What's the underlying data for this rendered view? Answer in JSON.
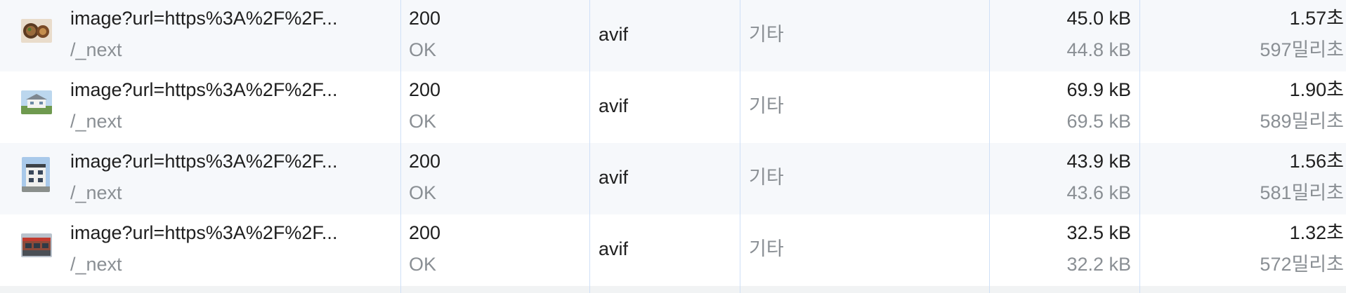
{
  "rows": [
    {
      "thumb_icon": "food-thumbnail-icon",
      "name": "image?url=https%3A%2F%2F...",
      "path": "/_next",
      "status_code": "200",
      "status_text": "OK",
      "type": "avif",
      "initiator": "기타",
      "transferred": "45.0 kB",
      "size": "44.8 kB",
      "time": "1.57초",
      "latency": "597밀리초"
    },
    {
      "thumb_icon": "house-thumbnail-icon",
      "name": "image?url=https%3A%2F%2F...",
      "path": "/_next",
      "status_code": "200",
      "status_text": "OK",
      "type": "avif",
      "initiator": "기타",
      "transferred": "69.9 kB",
      "size": "69.5 kB",
      "time": "1.90초",
      "latency": "589밀리초"
    },
    {
      "thumb_icon": "building-thumbnail-icon",
      "name": "image?url=https%3A%2F%2F...",
      "path": "/_next",
      "status_code": "200",
      "status_text": "OK",
      "type": "avif",
      "initiator": "기타",
      "transferred": "43.9 kB",
      "size": "43.6 kB",
      "time": "1.56초",
      "latency": "581밀리초"
    },
    {
      "thumb_icon": "storefront-thumbnail-icon",
      "name": "image?url=https%3A%2F%2F...",
      "path": "/_next",
      "status_code": "200",
      "status_text": "OK",
      "type": "avif",
      "initiator": "기타",
      "transferred": "32.5 kB",
      "size": "32.2 kB",
      "time": "1.32초",
      "latency": "572밀리초"
    }
  ]
}
